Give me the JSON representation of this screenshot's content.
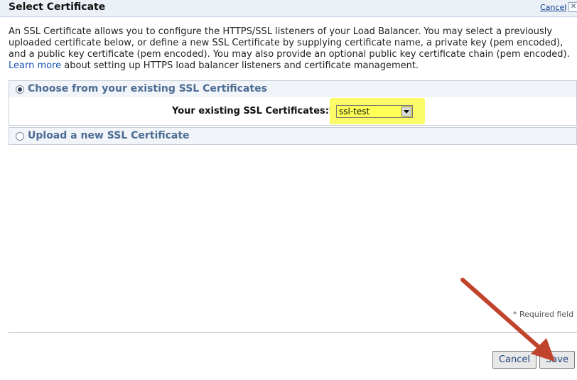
{
  "dialog": {
    "title": "Select Certificate",
    "cancel_link": "Cancel",
    "close_glyph": "✕"
  },
  "intro": {
    "text_before_link": "An SSL Certificate allows you to configure the HTTPS/SSL listeners of your Load Balancer. You may select a previously uploaded certificate below, or define a new SSL Certificate by supplying certificate name, a private key (pem encoded), and a public key certificate (pem encoded). You may also provide an optional public key certificate chain (pem encoded). ",
    "link_text": "Learn more",
    "text_after_link": " about setting up HTTPS load balancer listeners and certificate management."
  },
  "options": {
    "existing": {
      "label": "Choose from your existing SSL Certificates",
      "selected": true
    },
    "upload": {
      "label": "Upload a new SSL Certificate",
      "selected": false
    }
  },
  "existing_form": {
    "field_label": "Your existing SSL Certificates:*",
    "selected_value": "ssl-test"
  },
  "footer": {
    "required_note": "* Required field",
    "cancel_button": "Cancel",
    "save_button": "Save"
  },
  "colors": {
    "highlight": "#fbfb68",
    "annotation_arrow": "#c0432b",
    "link": "#1a56b3",
    "section_label": "#4c6c94"
  }
}
